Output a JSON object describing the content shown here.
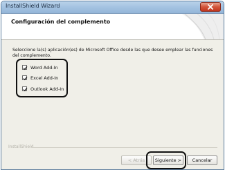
{
  "window": {
    "title": "InstallShield Wizard"
  },
  "header": {
    "title": "Configuración del complemento"
  },
  "content": {
    "description": "Seleccione la(s) aplicación(es) de Microsoft Office desde las que desee emplear las funciones del complemento.",
    "options": [
      {
        "label": "Word Add-In",
        "checked": true
      },
      {
        "label": "Excel Add-In",
        "checked": true
      },
      {
        "label": "Outlook Add-In",
        "checked": true
      }
    ]
  },
  "footer": {
    "brand": "InstallShield",
    "buttons": {
      "back": "< Atrás",
      "next": "Siguiente >",
      "cancel": "Cancelar"
    }
  },
  "colors": {
    "titlebar": "#a6c4e2",
    "close_button": "#c0351f",
    "dialog_background": "#f0efe8"
  }
}
